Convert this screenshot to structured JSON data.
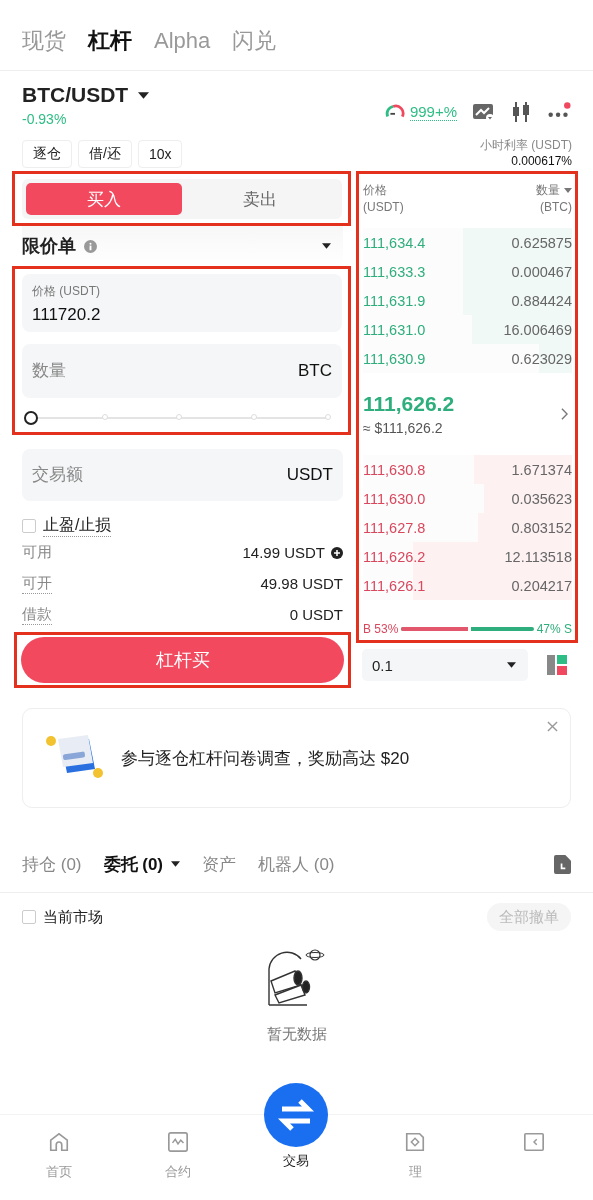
{
  "top_tabs": [
    {
      "label": "现货",
      "selected": false
    },
    {
      "label": "杠杆",
      "selected": true
    },
    {
      "label": "Alpha",
      "selected": false
    },
    {
      "label": "闪兑",
      "selected": false
    }
  ],
  "pair": {
    "symbol": "BTC/USDT",
    "change": "-0.93%",
    "sentiment": "999+%"
  },
  "margin_options": [
    "逐仓",
    "借/还",
    "10x"
  ],
  "hourly_rate": {
    "label": "小时利率 (USDT)",
    "value": "0.000617%"
  },
  "sides": [
    {
      "label": "买入",
      "selected": true
    },
    {
      "label": "卖出",
      "selected": false
    }
  ],
  "order_type": {
    "label": "限价单"
  },
  "price_field": {
    "label": "价格 (USDT)",
    "value": "111720.2"
  },
  "quantity_field": {
    "placeholder": "数量",
    "unit": "BTC"
  },
  "quantity_slider": {
    "level": 0
  },
  "amount_field": {
    "placeholder": "交易额",
    "unit": "USDT"
  },
  "tp_sl": {
    "label": "止盈/止损",
    "checked": false
  },
  "balances": [
    {
      "label": "可用",
      "value": "14.99 USDT",
      "kind": "deposit"
    },
    {
      "label": "可开",
      "value": "49.98 USDT",
      "kind": "plain"
    },
    {
      "label": "借款",
      "value": "0 USDT",
      "kind": "plain"
    }
  ],
  "submit_button": "杠杆买",
  "orderbook": {
    "price_header": "价格",
    "price_unit": "(USDT)",
    "qty_header": "数量",
    "qty_unit": "(BTC)",
    "upper_rows": [
      {
        "price": "111,634.4",
        "qty": "0.625875",
        "level": 0.52
      },
      {
        "price": "111,633.3",
        "qty": "0.000467",
        "level": 0.52
      },
      {
        "price": "111,631.9",
        "qty": "0.884424",
        "level": 0.52
      },
      {
        "price": "111,631.0",
        "qty": "16.006469",
        "level": 0.48
      },
      {
        "price": "111,630.9",
        "qty": "0.623029",
        "level": 0.16
      }
    ],
    "mid_price": "111,626.2",
    "mid_approx": "≈ $111,626.2",
    "lower_rows": [
      {
        "price": "111,630.8",
        "qty": "1.671374",
        "level": 0.47
      },
      {
        "price": "111,630.0",
        "qty": "0.035623",
        "level": 0.42
      },
      {
        "price": "111,627.8",
        "qty": "0.803152",
        "level": 0.45
      },
      {
        "price": "111,626.2",
        "qty": "12.113518",
        "level": 0.76
      },
      {
        "price": "111,626.1",
        "qty": "0.204217",
        "level": 0.76
      }
    ],
    "ratio": {
      "buy": "B 53%",
      "sell": "47% S",
      "level": 0.53
    }
  },
  "depth_select": {
    "value": "0.1"
  },
  "banner": {
    "text": "参与逐仓杠杆问卷调查，奖励高达 $20"
  },
  "order_tabs": [
    {
      "label": "持仓 (0)",
      "selected": false,
      "has_menu": false
    },
    {
      "label": "委托 (0)",
      "selected": true,
      "has_menu": true
    },
    {
      "label": "资产",
      "selected": false,
      "has_menu": false
    },
    {
      "label": "机器人 (0)",
      "selected": false,
      "has_menu": false
    }
  ],
  "market_filter": {
    "label": "当前市场",
    "checked": false
  },
  "cancel_all": {
    "label": "全部撤单",
    "disabled": true
  },
  "empty_state": {
    "text": "暂无数据"
  },
  "nav": [
    {
      "label": "首页",
      "selected": false,
      "kind": "home"
    },
    {
      "label": "合约",
      "selected": false,
      "kind": "chart"
    },
    {
      "label": "交易",
      "selected": true,
      "kind": "swap"
    },
    {
      "label": "理",
      "selected": false,
      "kind": "diamond"
    },
    {
      "selected": false,
      "kind": "wallet"
    }
  ]
}
